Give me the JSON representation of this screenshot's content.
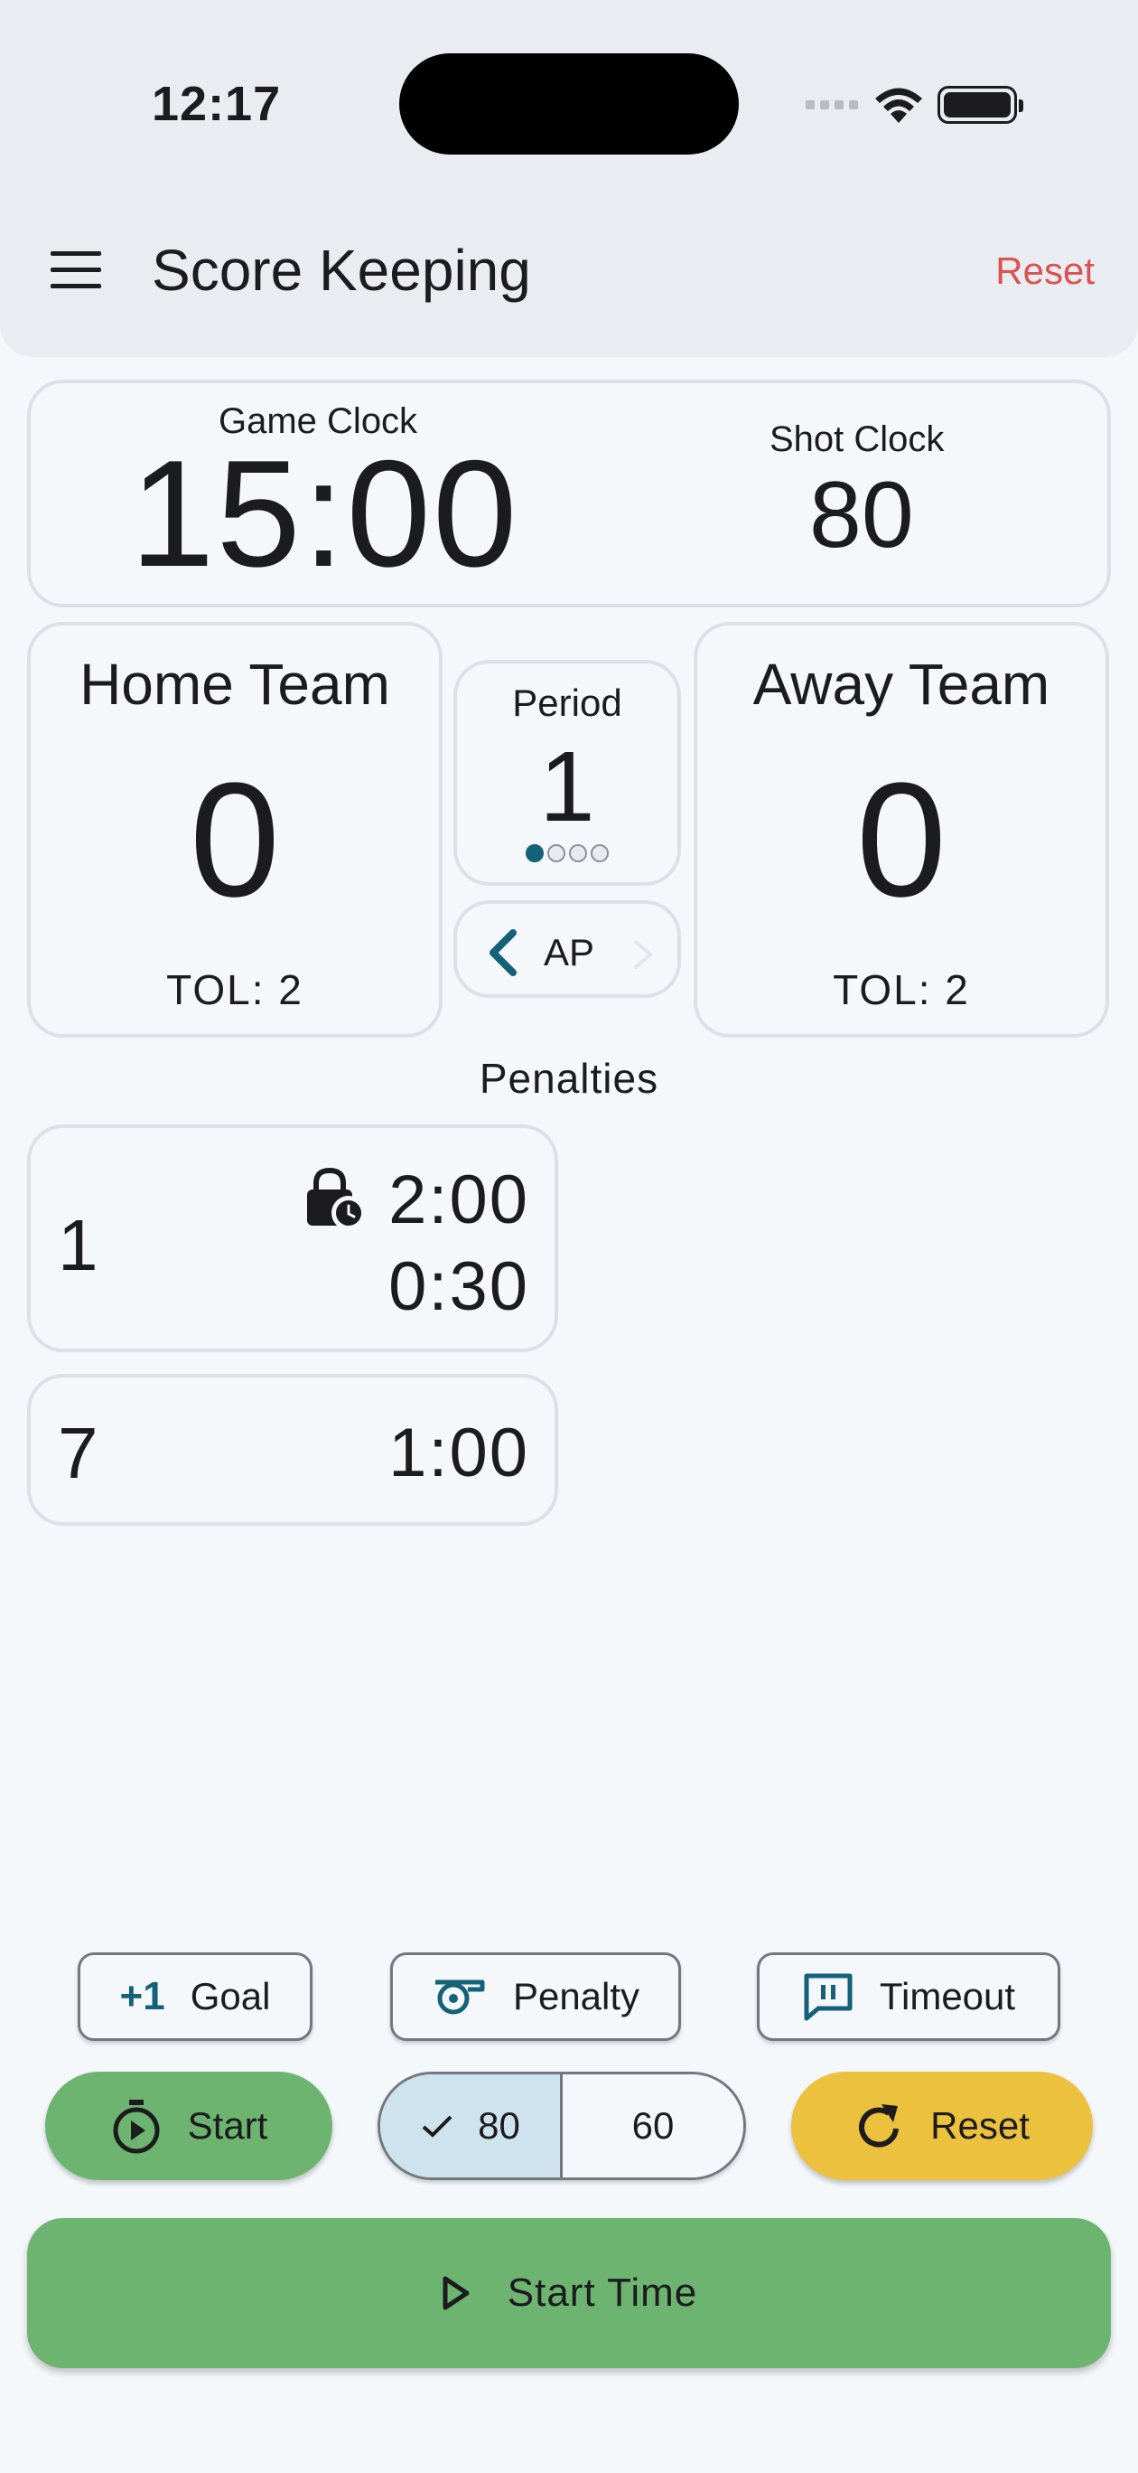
{
  "status_bar": {
    "time": "12:17",
    "icons": [
      "signal-icon",
      "wifi-icon",
      "battery-icon"
    ]
  },
  "app_bar": {
    "title": "Score Keeping",
    "reset_label": "Reset",
    "reset_color": "#d9534f"
  },
  "clocks": {
    "game_clock_label": "Game Clock",
    "game_clock_value": "15:00",
    "shot_clock_label": "Shot Clock",
    "shot_clock_value": "80"
  },
  "home": {
    "name": "Home Team",
    "score": "0",
    "tol": "TOL: 2"
  },
  "away": {
    "name": "Away Team",
    "score": "0",
    "tol": "TOL: 2"
  },
  "period": {
    "label": "Period",
    "value": "1",
    "dots_total": 4,
    "dots_active": 1
  },
  "possession": {
    "label": "AP"
  },
  "penalties": {
    "title": "Penalties",
    "items": [
      {
        "number": "1",
        "time_primary": "2:00",
        "time_secondary": "0:30",
        "icon": "lock-clock-icon"
      },
      {
        "number": "7",
        "time_primary": "1:00"
      }
    ]
  },
  "actions": {
    "goal_prefix": "+1",
    "goal_label": "Goal",
    "penalty_label": "Penalty",
    "timeout_label": "Timeout"
  },
  "controls": {
    "start_label": "Start",
    "shot_options": [
      "80",
      "60"
    ],
    "shot_selected": "80",
    "reset_label": "Reset",
    "start_time_label": "Start Time"
  },
  "colors": {
    "accent": "#14617a",
    "green": "#6db470",
    "yellow": "#ecc13e",
    "selected_segment": "#cfe3ee",
    "background": "#f4f8fb",
    "header": "#e9edf1"
  }
}
